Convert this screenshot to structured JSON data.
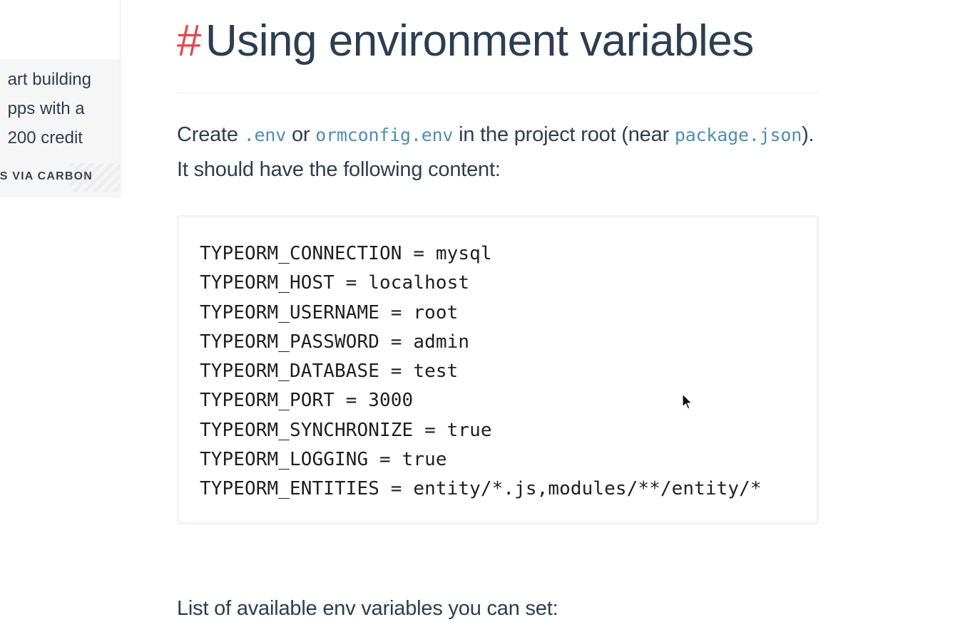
{
  "ad": {
    "lines": [
      "art building",
      "pps with a",
      "200 credit"
    ],
    "via": "S VIA CARBON"
  },
  "section": {
    "hash": "#",
    "title": "Using environment variables"
  },
  "intro": {
    "t1": "Create ",
    "c1": ".env",
    "t2": " or ",
    "c2": "ormconfig.env",
    "t3": " in the project root (near ",
    "c3": "package.json",
    "t4": "). It should have the following content:"
  },
  "code": {
    "lines": [
      "TYPEORM_CONNECTION = mysql",
      "TYPEORM_HOST = localhost",
      "TYPEORM_USERNAME = root",
      "TYPEORM_PASSWORD = admin",
      "TYPEORM_DATABASE = test",
      "TYPEORM_PORT = 3000",
      "TYPEORM_SYNCHRONIZE = true",
      "TYPEORM_LOGGING = true",
      "TYPEORM_ENTITIES = entity/*.js,modules/**/entity/*"
    ]
  },
  "list_intro": "List of available env variables you can set:",
  "colors": {
    "text": "#2c3e50",
    "hash": "#e4484a",
    "inline_code": "#4e8fb1",
    "code_border": "#f2f2f7"
  },
  "icons": {
    "cursor": "mouse-pointer-icon"
  }
}
